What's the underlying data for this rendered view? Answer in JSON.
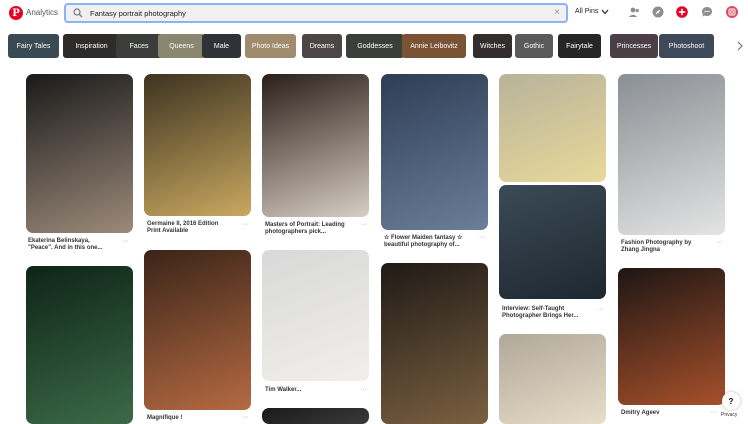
{
  "header": {
    "logo_letter": "P",
    "analytics_label": "Analytics",
    "search_query": "Fantasy portrait photography",
    "scope_label": "All Pins",
    "accent_color": "#e60023"
  },
  "guides": [
    {
      "label": "Fairy Tales",
      "color": "#3a4a52"
    },
    {
      "label": "Inspiration",
      "color": "#2e2b2b"
    },
    {
      "label": "Faces",
      "color": "#3b3d3b"
    },
    {
      "label": "Queens",
      "color": "#8a8670"
    },
    {
      "label": "Male",
      "color": "#2f3338"
    },
    {
      "label": "Photo Ideas",
      "color": "#a18b6e"
    },
    {
      "label": "Dreams",
      "color": "#4e4646"
    },
    {
      "label": "Goddesses",
      "color": "#3a3f3a"
    },
    {
      "label": "Annie Leibovitz",
      "color": "#7a5234"
    },
    {
      "label": "Witches",
      "color": "#332d2d"
    },
    {
      "label": "Gothic",
      "color": "#5a5a5a"
    },
    {
      "label": "Fairytale",
      "color": "#262626"
    },
    {
      "label": "Princesses",
      "color": "#4a3f44"
    },
    {
      "label": "Photoshoot",
      "color": "#3e4a5a"
    }
  ],
  "pins": [
    {
      "caption": "Ekaterina Belinskaya, \"Peace\". And in this one...",
      "top": "#1a1a1a",
      "bottom": "#9c8a7a"
    },
    {
      "caption": "Germaine II, 2016 Edition Print Available",
      "top": "#3d3320",
      "bottom": "#c9a860"
    },
    {
      "caption": "Masters of Portrait: Leading photographers pick...",
      "top": "#2a1e18",
      "bottom": "#d8cfc4"
    },
    {
      "caption": "☆ Flower Maiden fantasy ☆ beautiful photography of...",
      "top": "#2d3d55",
      "bottom": "#6b7e9a"
    },
    {
      "caption": "",
      "top": "#b8b39a",
      "bottom": "#e8d89a"
    },
    {
      "caption": "Interview: Self-Taught Photographer Brings Her...",
      "top": "#3b4a56",
      "bottom": "#1c2830"
    },
    {
      "caption": "Fashion Photography by Zhang Jingna",
      "top": "#8a8f94",
      "bottom": "#e4e4e4"
    },
    {
      "caption": "",
      "top": "#0e2416",
      "bottom": "#3b6a48"
    },
    {
      "caption": "Magnifique !",
      "top": "#3a2418",
      "bottom": "#b56a42"
    },
    {
      "caption": "Tim Walker...",
      "top": "#d8d8d8",
      "bottom": "#f0efeb"
    },
    {
      "caption": "",
      "top": "#1f1a16",
      "bottom": "#7a6040"
    },
    {
      "caption": "",
      "top": "#b0a89a",
      "bottom": "#e8ddc8"
    },
    {
      "caption": "Dmitry Ageev",
      "top": "#1e1614",
      "bottom": "#a6502a"
    },
    {
      "caption": "",
      "top": "#1a1a1a",
      "bottom": "#3a3a3a"
    }
  ],
  "more_label": "···",
  "help_label": "?",
  "privacy_label": "Privacy"
}
